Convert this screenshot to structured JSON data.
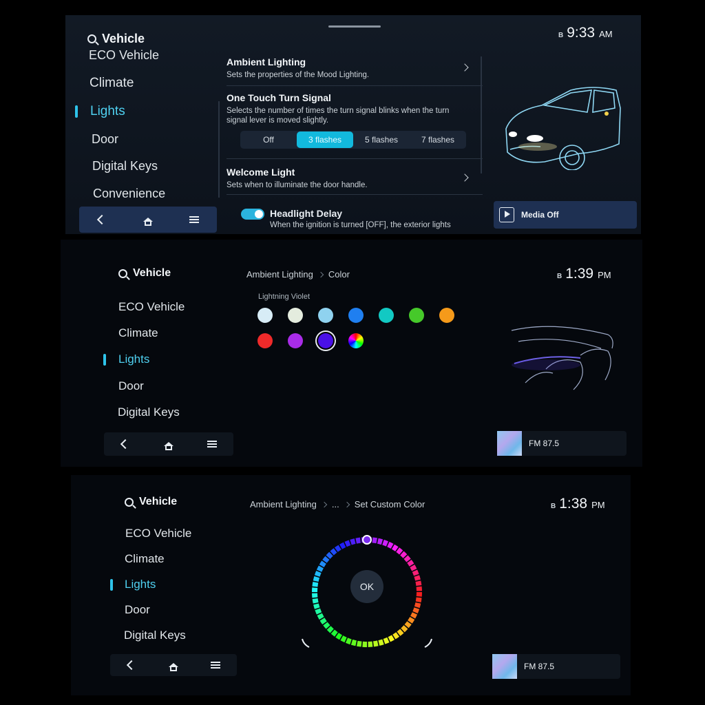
{
  "panel1": {
    "search_label": "Vehicle",
    "clock": "9:33",
    "ampm": "AM",
    "status_icon": "B",
    "menu": [
      "ECO Vehicle",
      "Climate",
      "Lights",
      "Door",
      "Digital Keys",
      "Convenience"
    ],
    "active_index": 2,
    "settings": {
      "ambient_title": "Ambient Lighting",
      "ambient_desc": "Sets the properties of the Mood Lighting.",
      "turn_title": "One Touch Turn Signal",
      "turn_desc": "Selects the number of times the turn signal blinks when the turn signal lever is moved slightly.",
      "turn_options": [
        "Off",
        "3 flashes",
        "5 flashes",
        "7 flashes"
      ],
      "turn_selected": 1,
      "welcome_title": "Welcome Light",
      "welcome_desc": "Sets when to illuminate the door handle.",
      "headlight_title": "Headlight Delay",
      "headlight_desc": "When the ignition is turned [OFF], the exterior lights"
    },
    "media_label": "Media Off"
  },
  "panel2": {
    "search_label": "Vehicle",
    "clock": "1:39",
    "ampm": "PM",
    "status_icon": "B",
    "menu": [
      "ECO Vehicle",
      "Climate",
      "Lights",
      "Door",
      "Digital Keys"
    ],
    "active_index": 2,
    "breadcrumb": [
      "Ambient Lighting",
      "Color"
    ],
    "color_name": "Lightning Violet",
    "swatches": [
      "#d7ecf6",
      "#e4ecde",
      "#8fd2ef",
      "#1f7ff0",
      "#12c9c3",
      "#46c92a",
      "#f59a1a",
      "#ef2a2a",
      "#a92ce8",
      "#4a10e6"
    ],
    "selected_swatch": 9,
    "media_label": "FM 87.5"
  },
  "panel3": {
    "search_label": "Vehicle",
    "clock": "1:38",
    "ampm": "PM",
    "status_icon": "B",
    "menu": [
      "ECO Vehicle",
      "Climate",
      "Lights",
      "Door",
      "Digital Keys"
    ],
    "active_index": 2,
    "breadcrumb": [
      "Ambient Lighting",
      "...",
      "Set Custom Color"
    ],
    "ok_label": "OK",
    "media_label": "FM 87.5"
  },
  "icons": {
    "search": "search-icon",
    "back": "chevron-left-icon",
    "home": "home-icon",
    "menu": "menu-icon",
    "play": "play-icon",
    "bluetooth": "bluetooth-icon",
    "chevron": "chevron-right-icon"
  },
  "colors": {
    "accent": "#2ec3ea",
    "selected_segment": "#12b9dd",
    "panel_bg": "#0c121b"
  }
}
